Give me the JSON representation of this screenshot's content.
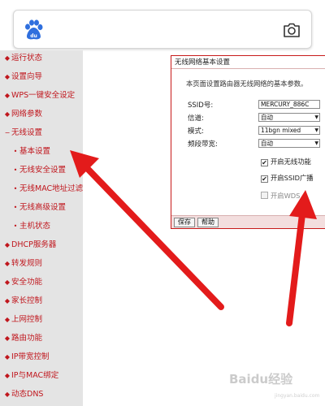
{
  "searchbar": {
    "logo_icon": "baidu-paw-icon",
    "camera_icon": "camera-icon"
  },
  "sidebar": {
    "items": [
      {
        "label": "运行状态",
        "level": "top"
      },
      {
        "label": "设置向导",
        "level": "top"
      },
      {
        "label": "WPS一键安全设定",
        "level": "top"
      },
      {
        "label": "网络参数",
        "level": "top"
      },
      {
        "label": "无线设置",
        "level": "top",
        "expanded": true
      },
      {
        "label": "基本设置",
        "level": "sub",
        "active": true
      },
      {
        "label": "无线安全设置",
        "level": "sub"
      },
      {
        "label": "无线MAC地址过滤",
        "level": "sub"
      },
      {
        "label": "无线高级设置",
        "level": "sub"
      },
      {
        "label": "主机状态",
        "level": "sub"
      },
      {
        "label": "DHCP服务器",
        "level": "top"
      },
      {
        "label": "转发规则",
        "level": "top"
      },
      {
        "label": "安全功能",
        "level": "top"
      },
      {
        "label": "家长控制",
        "level": "top"
      },
      {
        "label": "上网控制",
        "level": "top"
      },
      {
        "label": "路由功能",
        "level": "top"
      },
      {
        "label": "IP带宽控制",
        "level": "top"
      },
      {
        "label": "IP与MAC绑定",
        "level": "top"
      },
      {
        "label": "动态DNS",
        "level": "top"
      }
    ],
    "bullet_top": "◆",
    "bullet_expanded": "−",
    "bullet_sub": "•"
  },
  "panel": {
    "title": "无线网络基本设置",
    "description": "本页面设置路由器无线网络的基本参数。",
    "ssid_label": "SSID号:",
    "ssid_value": "MERCURY_886C",
    "channel_label": "信道:",
    "channel_value": "自动",
    "mode_label": "模式:",
    "mode_value": "11bgn mixed",
    "bandwidth_label": "频段带宽:",
    "bandwidth_value": "自动",
    "enable_wireless_label": "开启无线功能",
    "enable_wireless_checked": true,
    "enable_ssid_broadcast_label": "开启SSID广播",
    "enable_ssid_broadcast_checked": true,
    "enable_wds_label": "开启WDS",
    "enable_wds_checked": false,
    "save_label": "保存",
    "help_label": "帮助"
  },
  "watermark": {
    "text": "Baidu经验",
    "sub": "jingyan.baidu.com"
  },
  "colors": {
    "menu_text": "#c0161d",
    "sidebar_bg": "#e4e4e4",
    "panel_border": "#c71a1a",
    "arrow": "#e31b1b"
  }
}
